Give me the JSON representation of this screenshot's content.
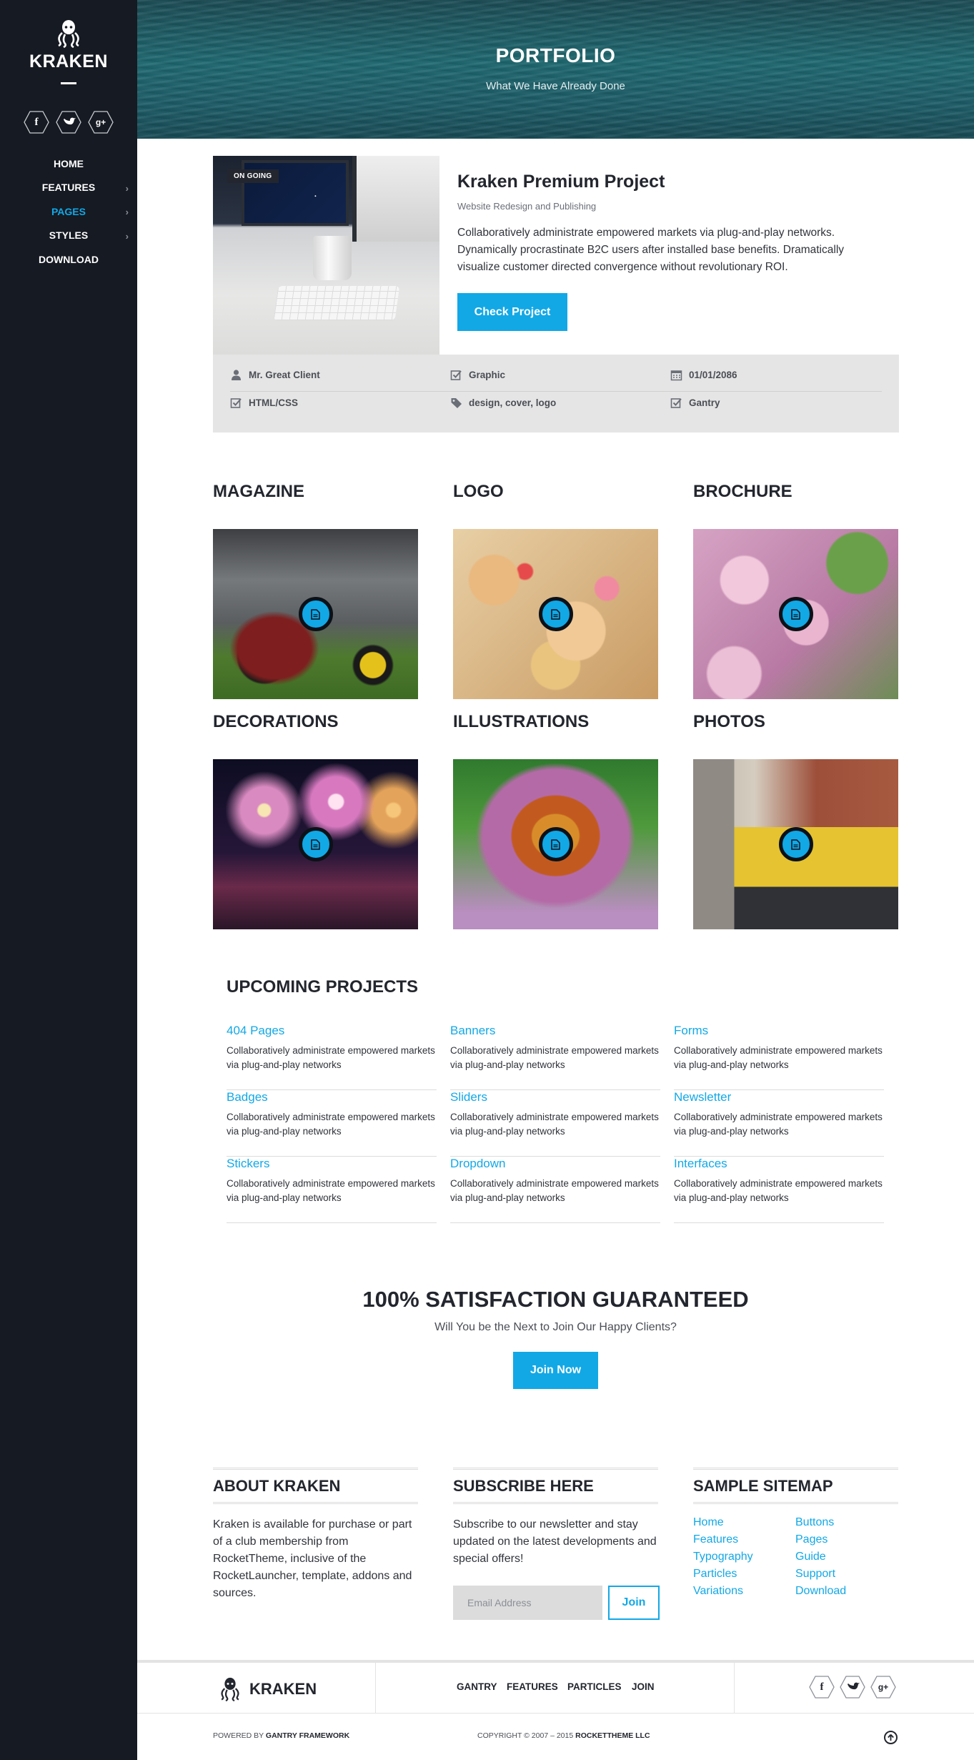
{
  "brand": {
    "name": "KRAKEN"
  },
  "sidebar": {
    "social": [
      {
        "icon": "facebook-icon",
        "glyph": "f"
      },
      {
        "icon": "twitter-icon",
        "glyph": "t"
      },
      {
        "icon": "google-plus-icon",
        "glyph": "g+"
      }
    ],
    "nav": [
      {
        "label": "HOME",
        "has_submenu": false,
        "active": false
      },
      {
        "label": "FEATURES",
        "has_submenu": true,
        "active": false
      },
      {
        "label": "PAGES",
        "has_submenu": true,
        "active": true
      },
      {
        "label": "STYLES",
        "has_submenu": true,
        "active": false
      },
      {
        "label": "DOWNLOAD",
        "has_submenu": false,
        "active": false
      }
    ]
  },
  "hero": {
    "title": "PORTFOLIO",
    "subtitle": "What We Have Already Done"
  },
  "featured": {
    "badge": "ON GOING",
    "title": "Kraken Premium Project",
    "subtitle": "Website Redesign and Publishing",
    "description": "Collaboratively administrate empowered markets via plug-and-play networks. Dynamically procrastinate B2C users after installed base benefits. Dramatically visualize customer directed convergence without revolutionary ROI.",
    "button": "Check Project",
    "meta": [
      {
        "icon": "user-icon",
        "text": "Mr. Great Client"
      },
      {
        "icon": "checkbox-icon",
        "text": "Graphic"
      },
      {
        "icon": "calendar-icon",
        "text": "01/01/2086"
      },
      {
        "icon": "checkbox-icon",
        "text": "HTML/CSS"
      },
      {
        "icon": "tag-icon",
        "text": "design, cover, logo"
      },
      {
        "icon": "checkbox-icon",
        "text": "Gantry"
      }
    ]
  },
  "categories": [
    {
      "title": "MAGAZINE"
    },
    {
      "title": "LOGO"
    },
    {
      "title": "BROCHURE"
    },
    {
      "title": "DECORATIONS"
    },
    {
      "title": "ILLUSTRATIONS"
    },
    {
      "title": "PHOTOS"
    }
  ],
  "upcoming": {
    "title": "UPCOMING PROJECTS",
    "items": [
      {
        "name": "404 Pages",
        "desc": "Collaboratively administrate empowered markets via plug-and-play networks"
      },
      {
        "name": "Banners",
        "desc": "Collaboratively administrate empowered markets via plug-and-play networks"
      },
      {
        "name": "Forms",
        "desc": "Collaboratively administrate empowered markets via plug-and-play networks"
      },
      {
        "name": "Badges",
        "desc": "Collaboratively administrate empowered markets via plug-and-play networks"
      },
      {
        "name": "Sliders",
        "desc": "Collaboratively administrate empowered markets via plug-and-play networks"
      },
      {
        "name": "Newsletter",
        "desc": "Collaboratively administrate empowered markets via plug-and-play networks"
      },
      {
        "name": "Stickers",
        "desc": "Collaboratively administrate empowered markets via plug-and-play networks"
      },
      {
        "name": "Dropdown",
        "desc": "Collaboratively administrate empowered markets via plug-and-play networks"
      },
      {
        "name": "Interfaces",
        "desc": "Collaboratively administrate empowered markets via plug-and-play networks"
      }
    ]
  },
  "cta": {
    "title": "100% SATISFACTION GUARANTEED",
    "subtitle": "Will You be the Next to Join Our Happy Clients?",
    "button": "Join Now"
  },
  "footer": {
    "about": {
      "title": "ABOUT KRAKEN",
      "text": "Kraken is available for purchase or part of a club membership from RocketTheme, inclusive of the RocketLauncher, template, addons and sources."
    },
    "subscribe": {
      "title": "SUBSCRIBE HERE",
      "text": "Subscribe to our newsletter and stay updated on the latest developments and special offers!",
      "placeholder": "Email Address",
      "button": "Join"
    },
    "sitemap": {
      "title": "SAMPLE SITEMAP",
      "left": [
        "Home",
        "Features",
        "Typography",
        "Particles",
        "Variations"
      ],
      "right": [
        "Buttons",
        "Pages",
        "Guide",
        "Support",
        "Download"
      ]
    }
  },
  "bottombar": {
    "nav": [
      "GANTRY",
      "FEATURES",
      "PARTICLES",
      "JOIN"
    ],
    "powered_prefix": "POWERED BY",
    "powered_name": "GANTRY FRAMEWORK",
    "copyright_prefix": "COPYRIGHT © 2007 – 2015",
    "copyright_name": "ROCKETTHEME LLC"
  },
  "colors": {
    "accent": "#12a8e6",
    "sidebar": "#161a22",
    "text": "#23262e"
  }
}
